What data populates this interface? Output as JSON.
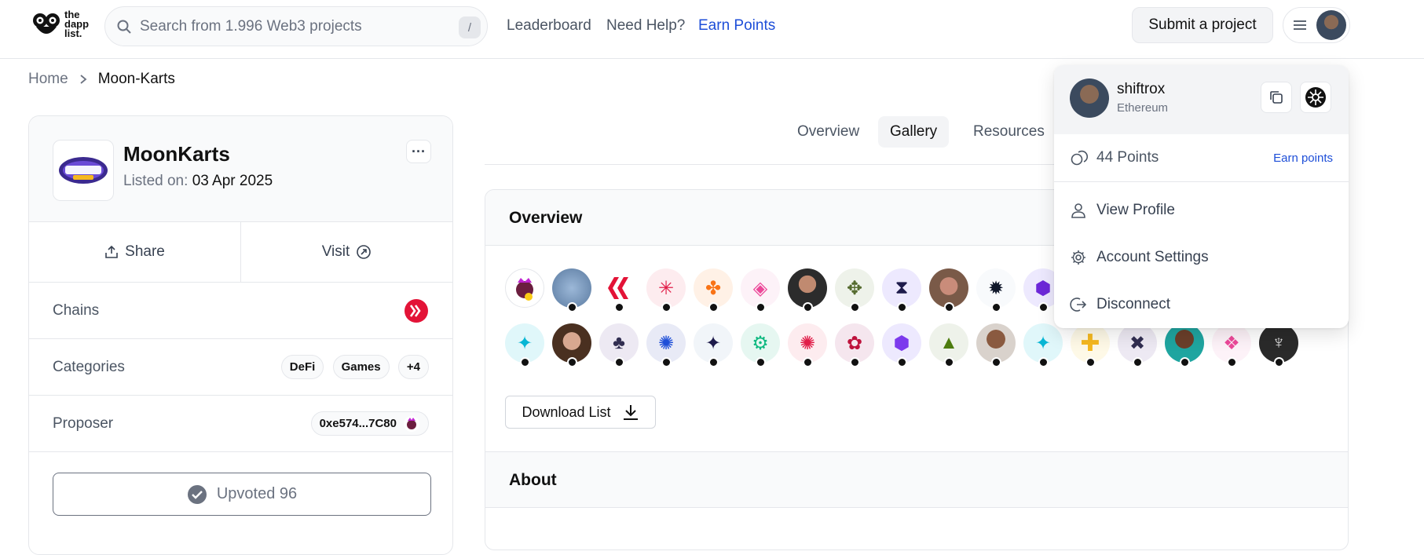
{
  "header": {
    "logo_text": "the dapp list.",
    "search_placeholder": "Search from 1.996 Web3 projects",
    "search_shortcut": "/",
    "nav": [
      "Leaderboard",
      "Need Help?",
      "Earn Points"
    ],
    "submit_label": "Submit a project"
  },
  "breadcrumb": {
    "home": "Home",
    "current": "Moon-Karts"
  },
  "project": {
    "name": "MoonKarts",
    "listed_label": "Listed on:",
    "listed_date": "03 Apr 2025",
    "more_label": "···",
    "share_label": "Share",
    "visit_label": "Visit",
    "chains_label": "Chains",
    "categories_label": "Categories",
    "categories": [
      "DeFi",
      "Games",
      "+4"
    ],
    "proposer_label": "Proposer",
    "proposer_address": "0xe574...7C80",
    "upvote_label": "Upvoted 96"
  },
  "tabs": [
    "Overview",
    "Gallery",
    "Resources"
  ],
  "overview": {
    "title": "Overview",
    "download_label": "Download List",
    "about_title": "About"
  },
  "colors": {
    "accent": "#1d4ed8",
    "hive_red": "#e31337"
  },
  "dropdown": {
    "username": "shiftrox",
    "chain": "Ethereum",
    "points": "44 Points",
    "earn_points": "Earn points",
    "items": [
      "View Profile",
      "Account Settings",
      "Disconnect"
    ]
  }
}
